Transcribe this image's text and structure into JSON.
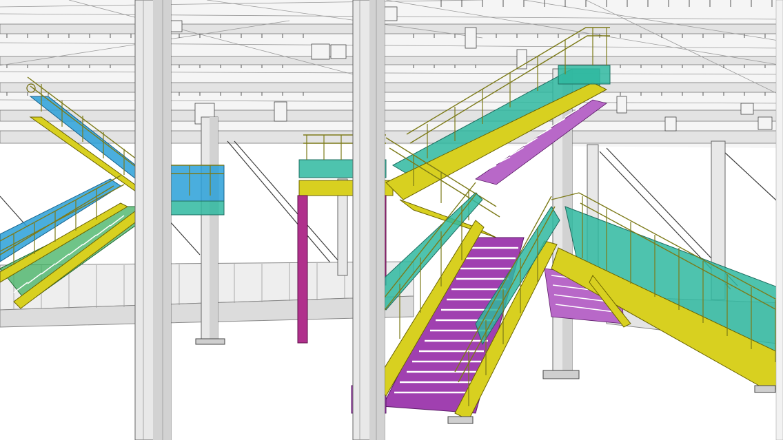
{
  "image": {
    "alt": "",
    "colors": {
      "structure": "#e6e6e6",
      "stringer": "#d8d020",
      "teal": "#2fb8a0",
      "blue": "#2aa0d8",
      "green": "#3fb060",
      "purple": "#a040b0",
      "magenta": "#b0308c",
      "background": "#ffffff"
    }
  }
}
